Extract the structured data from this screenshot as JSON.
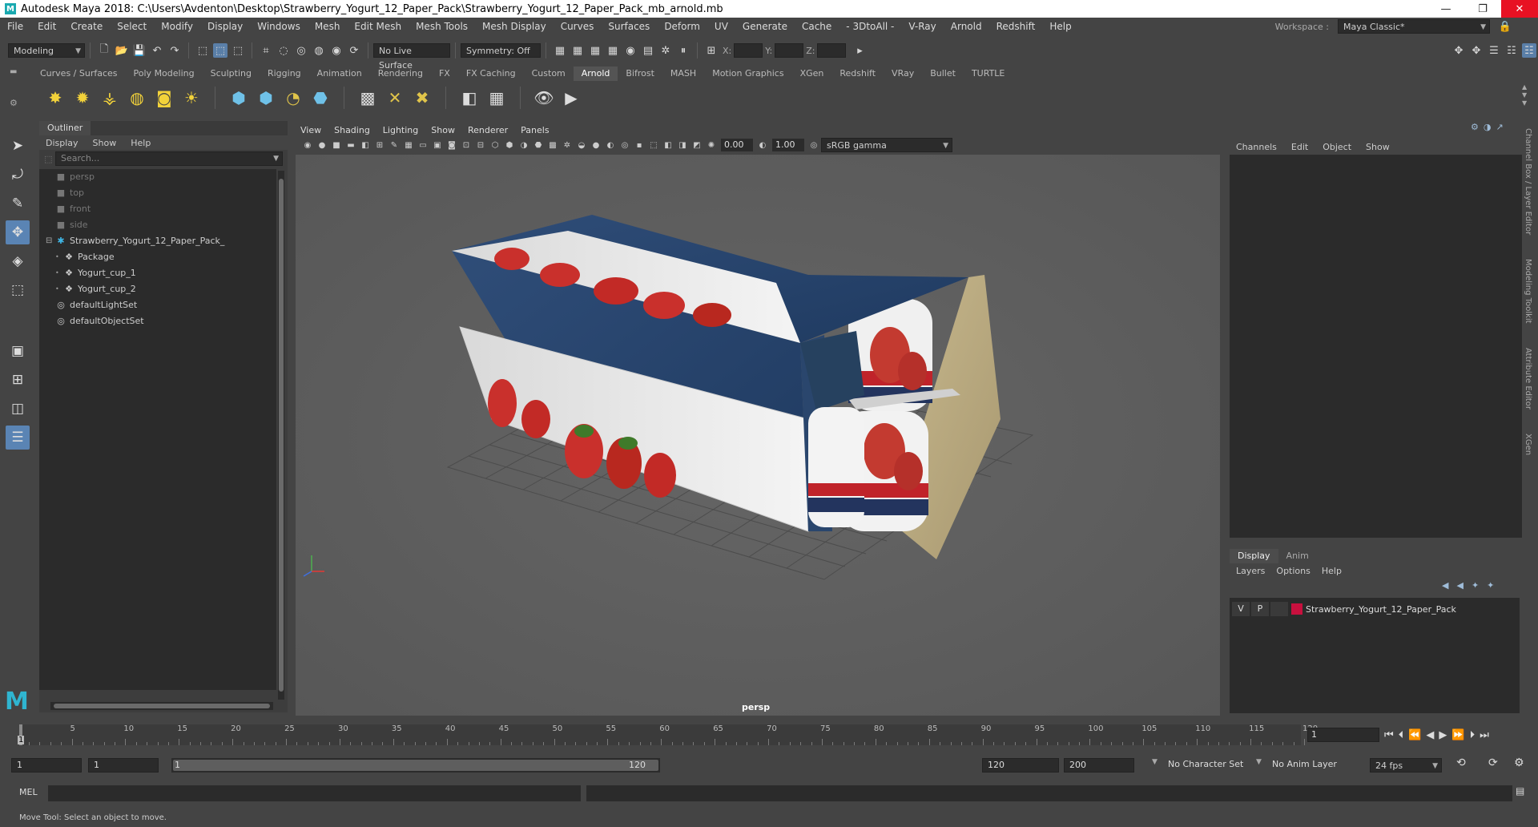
{
  "window": {
    "title": "Autodesk Maya 2018: C:\\Users\\Avdenton\\Desktop\\Strawberry_Yogurt_12_Paper_Pack\\Strawberry_Yogurt_12_Paper_Pack_mb_arnold.mb",
    "minimize": "—",
    "maximize": "❐",
    "close": "✕"
  },
  "menubar": {
    "items": [
      "File",
      "Edit",
      "Create",
      "Select",
      "Modify",
      "Display",
      "Windows",
      "Mesh",
      "Edit Mesh",
      "Mesh Tools",
      "Mesh Display",
      "Curves",
      "Surfaces",
      "Deform",
      "UV",
      "Generate",
      "Cache",
      "- 3DtoAll -",
      "V-Ray",
      "Arnold",
      "Redshift",
      "Help"
    ],
    "workspace_label": "Workspace :",
    "workspace_value": "Maya Classic*"
  },
  "statusline": {
    "mode": "Modeling",
    "live_surface": "No Live Surface",
    "symmetry": "Symmetry: Off",
    "x_label": "X:",
    "y_label": "Y:",
    "z_label": "Z:"
  },
  "shelf": {
    "tabs": [
      "Curves / Surfaces",
      "Poly Modeling",
      "Sculpting",
      "Rigging",
      "Animation",
      "Rendering",
      "FX",
      "FX Caching",
      "Custom",
      "Arnold",
      "Bifrost",
      "MASH",
      "Motion Graphics",
      "XGen",
      "Redshift",
      "VRay",
      "Bullet",
      "TURTLE"
    ],
    "active_tab": "Arnold"
  },
  "outliner": {
    "title": "Outliner",
    "menu": [
      "Display",
      "Show",
      "Help"
    ],
    "search_placeholder": "Search...",
    "items": [
      {
        "label": "persp",
        "icon": "camera-icon",
        "indent": 0,
        "dim": true
      },
      {
        "label": "top",
        "icon": "camera-icon",
        "indent": 0,
        "dim": true
      },
      {
        "label": "front",
        "icon": "camera-icon",
        "indent": 0,
        "dim": true
      },
      {
        "label": "side",
        "icon": "camera-icon",
        "indent": 0,
        "dim": true
      },
      {
        "label": "Strawberry_Yogurt_12_Paper_Pack_",
        "icon": "group-icon",
        "indent": 0,
        "dim": false
      },
      {
        "label": "Package",
        "icon": "mesh-icon",
        "indent": 1,
        "dim": false
      },
      {
        "label": "Yogurt_cup_1",
        "icon": "mesh-icon",
        "indent": 1,
        "dim": false
      },
      {
        "label": "Yogurt_cup_2",
        "icon": "mesh-icon",
        "indent": 1,
        "dim": false
      },
      {
        "label": "defaultLightSet",
        "icon": "set-icon",
        "indent": 0,
        "dim": false
      },
      {
        "label": "defaultObjectSet",
        "icon": "set-icon",
        "indent": 0,
        "dim": false
      }
    ]
  },
  "viewport": {
    "menu": [
      "View",
      "Shading",
      "Lighting",
      "Show",
      "Renderer",
      "Panels"
    ],
    "exposure": "0.00",
    "gamma": "1.00",
    "color_space": "sRGB gamma",
    "camera_label": "persp"
  },
  "channelbox": {
    "menu": [
      "Channels",
      "Edit",
      "Object",
      "Show"
    ],
    "side_tabs": [
      "Channel Box / Layer Editor",
      "Modeling Toolkit",
      "Attribute Editor",
      "XGen"
    ]
  },
  "layereditor": {
    "tabs": [
      "Display",
      "Anim"
    ],
    "active_tab": "Display",
    "menu": [
      "Layers",
      "Options",
      "Help"
    ],
    "layer": {
      "v": "V",
      "p": "P",
      "name": "Strawberry_Yogurt_12_Paper_Pack",
      "color": "#c8103e"
    }
  },
  "timeline": {
    "labels": [
      "1",
      "5",
      "10",
      "15",
      "20",
      "25",
      "30",
      "35",
      "40",
      "45",
      "50",
      "55",
      "60",
      "65",
      "70",
      "75",
      "80",
      "85",
      "90",
      "95",
      "100",
      "105",
      "110",
      "115",
      "120"
    ],
    "current_frame": "1"
  },
  "range": {
    "start": "1",
    "playback_start": "1",
    "slider_start": "1",
    "slider_end": "120",
    "playback_end": "120",
    "end": "200",
    "character_set": "No Character Set",
    "anim_layer": "No Anim Layer",
    "fps": "24 fps"
  },
  "command": {
    "mel_label": "MEL",
    "help_text": "Move Tool: Select an object to move."
  }
}
